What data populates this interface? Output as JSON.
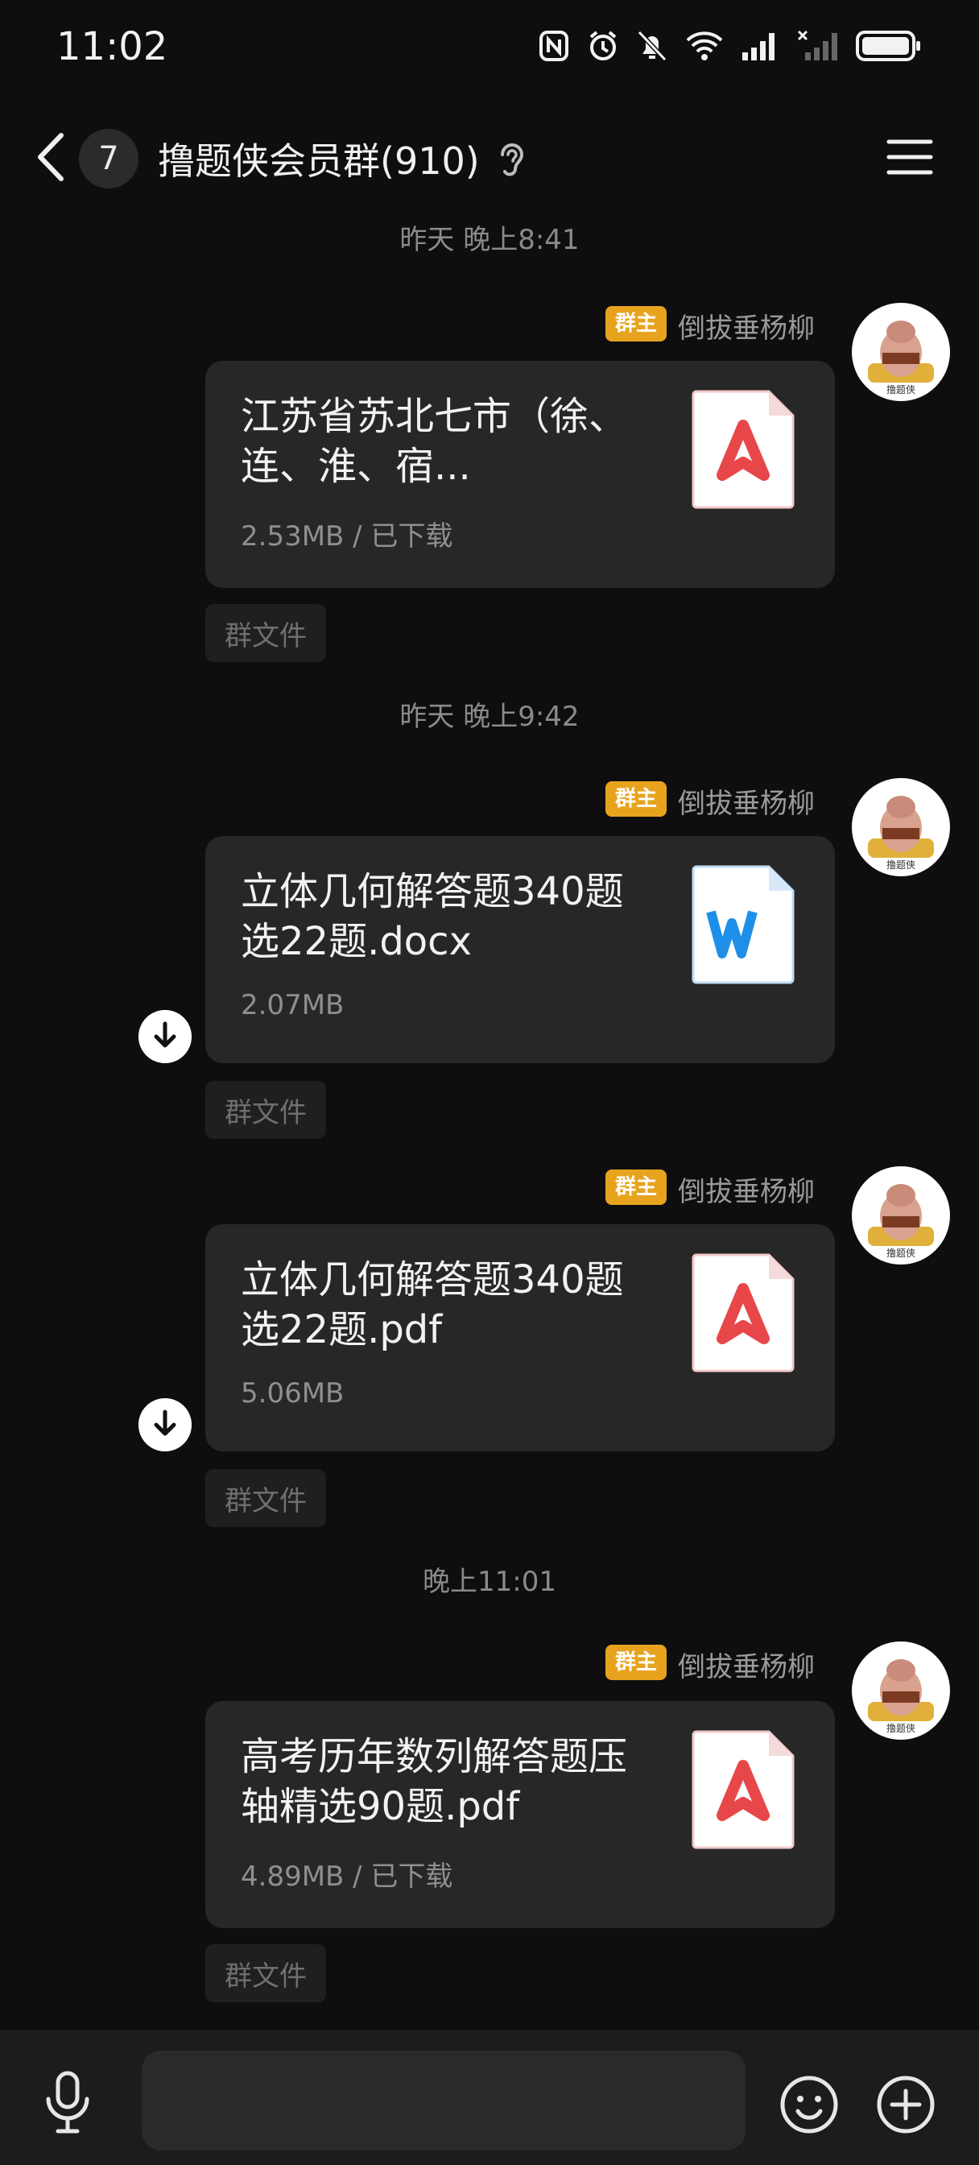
{
  "status": {
    "time": "11:02"
  },
  "header": {
    "unread_count": "7",
    "group_title": "撸题侠会员群(910)"
  },
  "messages": [
    {
      "timestamp": "昨天 晚上8:41",
      "role_badge": "群主",
      "sender": "倒拔垂杨柳",
      "file_name": "江苏省苏北七市（徐、连、淮、宿...",
      "file_meta": "2.53MB / 已下载",
      "file_type": "pdf",
      "tag": "群文件"
    },
    {
      "timestamp": "昨天 晚上9:42",
      "role_badge": "群主",
      "sender": "倒拔垂杨柳",
      "file_name": "立体几何解答题340题选22题.docx",
      "file_meta": "2.07MB",
      "file_type": "word",
      "tag": "群文件"
    },
    {
      "role_badge": "群主",
      "sender": "倒拔垂杨柳",
      "file_name": "立体几何解答题340题选22题.pdf",
      "file_meta": "5.06MB",
      "file_type": "pdf",
      "tag": "群文件"
    },
    {
      "timestamp": "晚上11:01",
      "role_badge": "群主",
      "sender": "倒拔垂杨柳",
      "file_name": "高考历年数列解答题压轴精选90题.pdf",
      "file_meta": "4.89MB / 已下载",
      "file_type": "pdf",
      "tag": "群文件"
    }
  ],
  "colors": {
    "background": "#0e0e0e",
    "bubble": "#272727",
    "owner_badge": "#e8a31e",
    "pdf_red": "#e8474a",
    "word_blue": "#1e8fe8"
  },
  "icons": [
    "back-arrow-icon",
    "ear-icon",
    "menu-icon",
    "microphone-icon",
    "emoji-icon",
    "plus-icon",
    "pdf-icon",
    "word-icon",
    "download-icon"
  ]
}
